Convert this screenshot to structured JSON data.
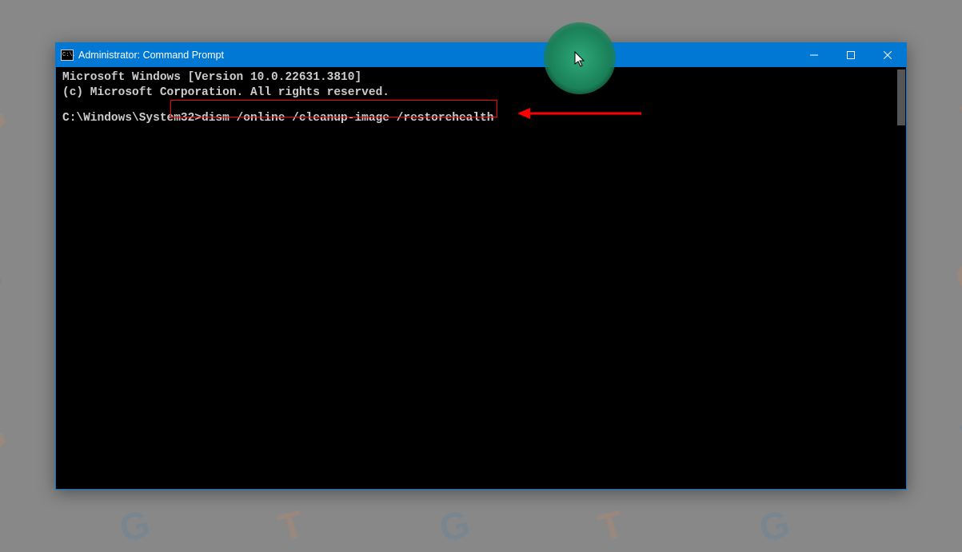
{
  "window": {
    "title": "Administrator: Command Prompt",
    "icon_text": "C:\\."
  },
  "terminal": {
    "line1": "Microsoft Windows [Version 10.0.22631.3810]",
    "line2": "(c) Microsoft Corporation. All rights reserved.",
    "prompt_path": "C:\\Windows\\System32>",
    "command": "dism /online /cleanup-image /restorehealth"
  },
  "annotations": {
    "highlight_color": "#ff0000",
    "arrow_color": "#ff0000"
  }
}
